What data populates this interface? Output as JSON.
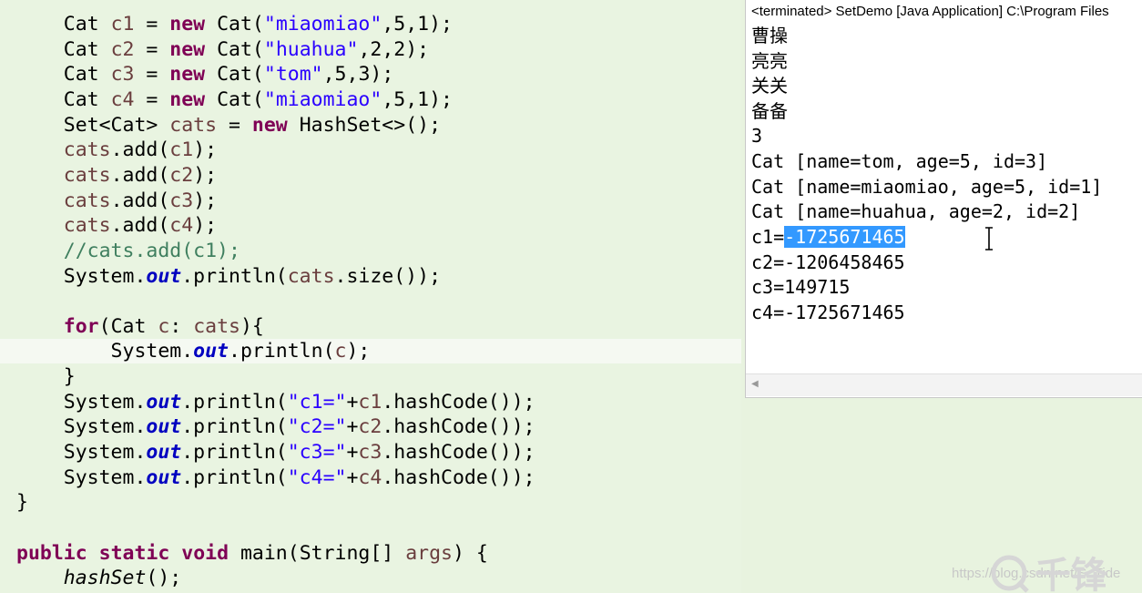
{
  "editor": {
    "lines": [
      {
        "top": 0,
        "tokens": []
      },
      {
        "tokens": [
          {
            "t": "    Cat "
          },
          {
            "t": "c1",
            "c": "var"
          },
          {
            "t": " = "
          },
          {
            "t": "new",
            "c": "kw"
          },
          {
            "t": " Cat("
          },
          {
            "t": "\"miaomiao\"",
            "c": "str"
          },
          {
            "t": ",5,1);"
          }
        ]
      },
      {
        "tokens": [
          {
            "t": "    Cat "
          },
          {
            "t": "c2",
            "c": "var"
          },
          {
            "t": " = "
          },
          {
            "t": "new",
            "c": "kw"
          },
          {
            "t": " Cat("
          },
          {
            "t": "\"huahua\"",
            "c": "str"
          },
          {
            "t": ",2,2);"
          }
        ]
      },
      {
        "tokens": [
          {
            "t": "    Cat "
          },
          {
            "t": "c3",
            "c": "var"
          },
          {
            "t": " = "
          },
          {
            "t": "new",
            "c": "kw"
          },
          {
            "t": " Cat("
          },
          {
            "t": "\"tom\"",
            "c": "str"
          },
          {
            "t": ",5,3);"
          }
        ]
      },
      {
        "tokens": [
          {
            "t": "    Cat "
          },
          {
            "t": "c4",
            "c": "var"
          },
          {
            "t": " = "
          },
          {
            "t": "new",
            "c": "kw"
          },
          {
            "t": " Cat("
          },
          {
            "t": "\"miaomiao\"",
            "c": "str"
          },
          {
            "t": ",5,1);"
          }
        ]
      },
      {
        "tokens": [
          {
            "t": "    Set<Cat> "
          },
          {
            "t": "cats",
            "c": "var"
          },
          {
            "t": " = "
          },
          {
            "t": "new",
            "c": "kw"
          },
          {
            "t": " HashSet<>();"
          }
        ]
      },
      {
        "tokens": [
          {
            "t": "    "
          },
          {
            "t": "cats",
            "c": "var"
          },
          {
            "t": ".add("
          },
          {
            "t": "c1",
            "c": "var"
          },
          {
            "t": ");"
          }
        ]
      },
      {
        "tokens": [
          {
            "t": "    "
          },
          {
            "t": "cats",
            "c": "var"
          },
          {
            "t": ".add("
          },
          {
            "t": "c2",
            "c": "var"
          },
          {
            "t": ");"
          }
        ]
      },
      {
        "tokens": [
          {
            "t": "    "
          },
          {
            "t": "cats",
            "c": "var"
          },
          {
            "t": ".add("
          },
          {
            "t": "c3",
            "c": "var"
          },
          {
            "t": ");"
          }
        ]
      },
      {
        "tokens": [
          {
            "t": "    "
          },
          {
            "t": "cats",
            "c": "var"
          },
          {
            "t": ".add("
          },
          {
            "t": "c4",
            "c": "var"
          },
          {
            "t": ");"
          }
        ]
      },
      {
        "tokens": [
          {
            "t": "    "
          },
          {
            "t": "//cats.add(c1);",
            "c": "cmt"
          }
        ]
      },
      {
        "tokens": [
          {
            "t": "    System."
          },
          {
            "t": "out",
            "c": "fld"
          },
          {
            "t": ".println("
          },
          {
            "t": "cats",
            "c": "var"
          },
          {
            "t": ".size());"
          }
        ]
      },
      {
        "tokens": [
          {
            "t": ""
          }
        ]
      },
      {
        "tokens": [
          {
            "t": "    "
          },
          {
            "t": "for",
            "c": "kw"
          },
          {
            "t": "(Cat "
          },
          {
            "t": "c",
            "c": "var"
          },
          {
            "t": ": "
          },
          {
            "t": "cats",
            "c": "var"
          },
          {
            "t": "){"
          }
        ]
      },
      {
        "current": true,
        "tokens": [
          {
            "t": "        System."
          },
          {
            "t": "out",
            "c": "fld"
          },
          {
            "t": ".println("
          },
          {
            "t": "c",
            "c": "var"
          },
          {
            "t": ");"
          }
        ]
      },
      {
        "tokens": [
          {
            "t": "    }"
          }
        ]
      },
      {
        "tokens": [
          {
            "t": "    System."
          },
          {
            "t": "out",
            "c": "fld"
          },
          {
            "t": ".println("
          },
          {
            "t": "\"c1=\"",
            "c": "str"
          },
          {
            "t": "+"
          },
          {
            "t": "c1",
            "c": "var"
          },
          {
            "t": ".hashCode());"
          }
        ]
      },
      {
        "tokens": [
          {
            "t": "    System."
          },
          {
            "t": "out",
            "c": "fld"
          },
          {
            "t": ".println("
          },
          {
            "t": "\"c2=\"",
            "c": "str"
          },
          {
            "t": "+"
          },
          {
            "t": "c2",
            "c": "var"
          },
          {
            "t": ".hashCode());"
          }
        ]
      },
      {
        "tokens": [
          {
            "t": "    System."
          },
          {
            "t": "out",
            "c": "fld"
          },
          {
            "t": ".println("
          },
          {
            "t": "\"c3=\"",
            "c": "str"
          },
          {
            "t": "+"
          },
          {
            "t": "c3",
            "c": "var"
          },
          {
            "t": ".hashCode());"
          }
        ]
      },
      {
        "tokens": [
          {
            "t": "    System."
          },
          {
            "t": "out",
            "c": "fld"
          },
          {
            "t": ".println("
          },
          {
            "t": "\"c4=\"",
            "c": "str"
          },
          {
            "t": "+"
          },
          {
            "t": "c4",
            "c": "var"
          },
          {
            "t": ".hashCode());"
          }
        ]
      },
      {
        "tokens": [
          {
            "t": "}"
          }
        ]
      },
      {
        "tokens": [
          {
            "t": ""
          }
        ]
      },
      {
        "tokens": [
          {
            "t": "public",
            "c": "kw"
          },
          {
            "t": " "
          },
          {
            "t": "static",
            "c": "kw"
          },
          {
            "t": " "
          },
          {
            "t": "void",
            "c": "kw"
          },
          {
            "t": " main(String[] "
          },
          {
            "t": "args",
            "c": "var"
          },
          {
            "t": ") {"
          }
        ]
      },
      {
        "tokens": [
          {
            "t": "    "
          },
          {
            "t": "hashSet",
            "c": "itl"
          },
          {
            "t": "();"
          }
        ]
      }
    ]
  },
  "console": {
    "header": "<terminated> SetDemo [Java Application] C:\\Program Files",
    "lines": [
      {
        "text": "曹操",
        "cjk": true
      },
      {
        "text": "亮亮",
        "cjk": true
      },
      {
        "text": "关关",
        "cjk": true
      },
      {
        "text": "备备",
        "cjk": true
      },
      {
        "text": "3"
      },
      {
        "text": "Cat [name=tom, age=5, id=3]"
      },
      {
        "text": "Cat [name=miaomiao, age=5, id=1]"
      },
      {
        "text": "Cat [name=huahua, age=2, id=2]"
      },
      {
        "text": "c1=",
        "selected": "-1725671465"
      },
      {
        "text": "c2=-1206458465"
      },
      {
        "text": "c3=149715"
      },
      {
        "text": "c4=-1725671465"
      }
    ]
  },
  "watermark": {
    "text": "https://blog.csdn.net/S_Tide",
    "logo_text": "千锋"
  }
}
